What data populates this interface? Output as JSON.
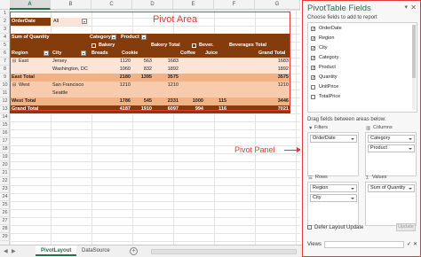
{
  "sheet": {
    "columns": [
      "A",
      "B",
      "C",
      "D",
      "E",
      "F",
      "G"
    ],
    "selected_column": "A",
    "rows": [
      "1",
      "2",
      "3",
      "4",
      "5",
      "6",
      "7",
      "8",
      "9",
      "10",
      "11",
      "12",
      "13",
      "14",
      "15",
      "16",
      "17",
      "18",
      "19",
      "20",
      "21",
      "22",
      "23",
      "24",
      "25",
      "26",
      "27",
      "28",
      "29"
    ]
  },
  "pivot": {
    "filter_label": "OrderDate",
    "filter_value": "All",
    "values_label": "Sum of Quantity",
    "col_header_category": "Category",
    "col_header_product": "Product",
    "bakery": "Bakery",
    "bakery_total": "Bakery Total",
    "beverages": "Bever.",
    "beverages_total": "Beverages Total",
    "grand_total_header": "Grand Total",
    "row_region": "Region",
    "row_city": "City",
    "prod_breads": "Breads",
    "prod_cookie": "Cookie",
    "prod_coffee": "Coffee",
    "prod_juice": "Juice",
    "east": "East",
    "jersey": "Jersey",
    "washington": "Washington, DC",
    "east_total": "East Total",
    "west": "West",
    "sanfran": "San Francisco",
    "seattle": "Seattle",
    "west_total": "West Total",
    "grand_total": "Grand Total",
    "values": {
      "jersey": [
        "1120",
        "563",
        "1683",
        "",
        "",
        "",
        "1683"
      ],
      "washington": [
        "1060",
        "832",
        "1892",
        "",
        "",
        "",
        "1892"
      ],
      "east_total": [
        "2180",
        "1395",
        "3575",
        "",
        "",
        "",
        "3575"
      ],
      "sanfran": [
        "1210",
        "",
        "1210",
        "",
        "",
        "",
        "1210"
      ],
      "seattle": [
        "",
        "",
        "",
        "",
        "",
        "",
        ""
      ],
      "west_total": [
        "1786",
        "545",
        "2331",
        "",
        "",
        "",
        "2331"
      ],
      "grand_total": [
        "4187",
        "1910",
        "6097",
        "994",
        "",
        "",
        "7021"
      ]
    },
    "values_partial": {
      "west_total_far": [
        "1000",
        "115",
        "",
        "3446"
      ],
      "grand_far": [
        "994",
        "116",
        "",
        "7021"
      ]
    }
  },
  "labels": {
    "pivot_area": "Pivot Area",
    "pivot_panel": "Pivot Panel"
  },
  "tabs": {
    "active": "PivotLayout",
    "other": "DataSource",
    "add": "+"
  },
  "panel": {
    "title": "PivotTable Fields",
    "subtitle": "Choose fields to add to report",
    "fields": [
      {
        "label": "OrderDate",
        "checked": true
      },
      {
        "label": "Region",
        "checked": true
      },
      {
        "label": "City",
        "checked": true
      },
      {
        "label": "Category",
        "checked": true
      },
      {
        "label": "Product",
        "checked": true
      },
      {
        "label": "Quantity",
        "checked": true
      },
      {
        "label": "UnitPrice",
        "checked": false
      },
      {
        "label": "TotalPrice",
        "checked": false
      }
    ],
    "drag_label": "Drag fields between areas below:",
    "filters_title": "Filters",
    "columns_title": "Columns",
    "rows_title": "Rows",
    "values_title": "Values",
    "filters_chips": [
      "OrderDate"
    ],
    "columns_chips": [
      "Category",
      "Product"
    ],
    "rows_chips": [
      "Region",
      "City"
    ],
    "values_chips": [
      "Sum of Quantity"
    ],
    "defer_label": "Defer Layout Update",
    "update_label": "Update",
    "views_label": "Views"
  },
  "colors": {
    "header": "#843c0c",
    "accent_red": "#e53935",
    "excel_green": "#217346"
  }
}
